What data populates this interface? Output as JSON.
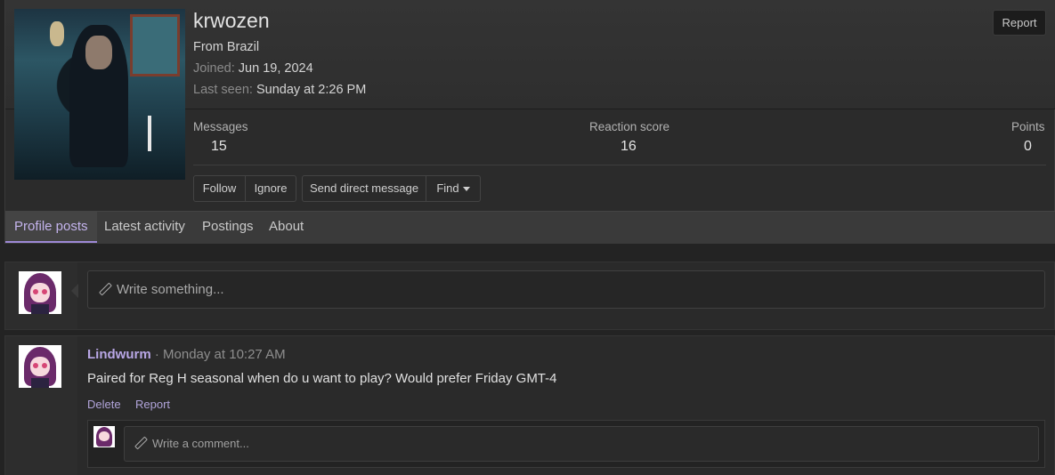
{
  "profile": {
    "username": "krwozen",
    "location": "From Brazil",
    "joined_label": "Joined:",
    "joined_value": "Jun 19, 2024",
    "last_seen_label": "Last seen:",
    "last_seen_value": "Sunday at 2:26 PM",
    "report_label": "Report"
  },
  "stats": {
    "messages_label": "Messages",
    "messages_value": "15",
    "reaction_label": "Reaction score",
    "reaction_value": "16",
    "points_label": "Points",
    "points_value": "0"
  },
  "actions": {
    "follow": "Follow",
    "ignore": "Ignore",
    "send_dm": "Send direct message",
    "find": "Find"
  },
  "tabs": [
    {
      "label": "Profile posts",
      "active": true
    },
    {
      "label": "Latest activity",
      "active": false
    },
    {
      "label": "Postings",
      "active": false
    },
    {
      "label": "About",
      "active": false
    }
  ],
  "composer": {
    "placeholder": "Write something..."
  },
  "post": {
    "author": "Lindwurm",
    "separator": " · ",
    "time": "Monday at 10:27 AM",
    "text": "Paired for Reg H seasonal when do u want to play? Would prefer Friday GMT-4",
    "delete_label": "Delete",
    "report_label": "Report",
    "comment_placeholder": "Write a comment..."
  },
  "icons": {
    "composer": "pencil-icon",
    "comment": "pencil-icon",
    "find_dropdown": "caret-down-icon"
  },
  "colors": {
    "accent": "#9d88d6",
    "link": "#b9a7e6"
  }
}
